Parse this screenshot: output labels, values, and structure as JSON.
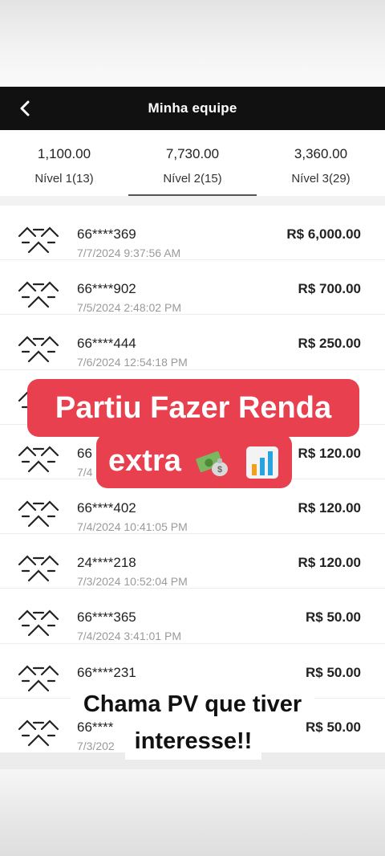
{
  "header": {
    "title": "Minha equipe",
    "back_icon": "chevron-left-icon"
  },
  "tabs": [
    {
      "amount": "1,100.00",
      "label": "Nível 1(13)",
      "active": false
    },
    {
      "amount": "7,730.00",
      "label": "Nível 2(15)",
      "active": true
    },
    {
      "amount": "3,360.00",
      "label": "Nível 3(29)",
      "active": false
    }
  ],
  "members": [
    {
      "phone": "66****369",
      "date": "7/7/2024 9:37:56 AM",
      "value": "R$ 6,000.00"
    },
    {
      "phone": "66****902",
      "date": "7/5/2024 2:48:02 PM",
      "value": "R$ 700.00"
    },
    {
      "phone": "66****444",
      "date": "7/6/2024 12:54:18 PM",
      "value": "R$ 250.00"
    },
    {
      "phone": "",
      "date": "",
      "value": ""
    },
    {
      "phone": "66",
      "date": "7/4",
      "value": "R$ 120.00"
    },
    {
      "phone": "66****402",
      "date": "7/4/2024 10:41:05 PM",
      "value": "R$ 120.00"
    },
    {
      "phone": "24****218",
      "date": "7/3/2024 10:52:04 PM",
      "value": "R$ 120.00"
    },
    {
      "phone": "66****365",
      "date": "7/4/2024 3:41:01 PM",
      "value": "R$ 50.00"
    },
    {
      "phone": "66****231",
      "date": "",
      "value": "R$ 50.00"
    },
    {
      "phone": "66****",
      "date": "7/3/202",
      "value": "R$ 50.00"
    }
  ],
  "overlay": {
    "banner_line1": "Partiu Fazer Renda",
    "banner_line2": "extra",
    "banner_emojis": [
      "money-bag-icon",
      "bar-chart-icon"
    ],
    "caption_line1": "Chama PV que tiver",
    "caption_line2": "interesse!!",
    "banner_color": "#e8404e"
  }
}
